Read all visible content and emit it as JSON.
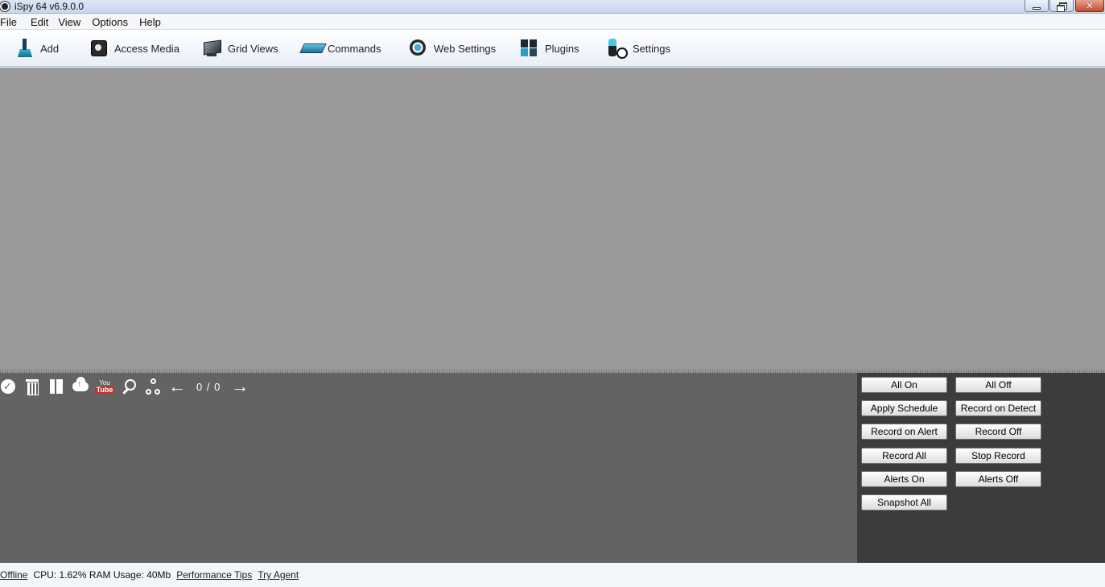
{
  "window": {
    "title": "iSpy 64 v6.9.0.0"
  },
  "menu": [
    "File",
    "Edit",
    "View",
    "Options",
    "Help"
  ],
  "toolbar": {
    "add": "Add",
    "access_media": "Access Media",
    "grid_views": "Grid Views",
    "commands": "Commands",
    "web_settings": "Web Settings",
    "plugins": "Plugins",
    "settings": "Settings"
  },
  "media_tools": {
    "counter": "0 / 0",
    "youtube_top": "You",
    "youtube_bottom": "Tube",
    "icons": [
      "select-all-icon",
      "delete-icon",
      "bookmark-icon",
      "upload-cloud-icon",
      "youtube-icon",
      "search-icon",
      "share-icon",
      "previous-arrow-icon",
      "next-arrow-icon"
    ]
  },
  "controls": {
    "all_on": "All On",
    "all_off": "All Off",
    "apply_schedule": "Apply Schedule",
    "record_on_detect": "Record on Detect",
    "record_on_alert": "Record on Alert",
    "record_off": "Record Off",
    "record_all": "Record All",
    "stop_record": "Stop Record",
    "alerts_on": "Alerts On",
    "alerts_off": "Alerts Off",
    "snapshot_all": "Snapshot All"
  },
  "status": {
    "connection": "Offline",
    "usage": "CPU: 1.62% RAM Usage: 40Mb",
    "performance_tips": "Performance Tips",
    "try_agent": "Try Agent"
  },
  "colors": {
    "viewport_bg": "#999999",
    "media_pane_bg": "#636363",
    "control_pane_bg": "#3c3c3c",
    "youtube_red": "#c4302b"
  }
}
